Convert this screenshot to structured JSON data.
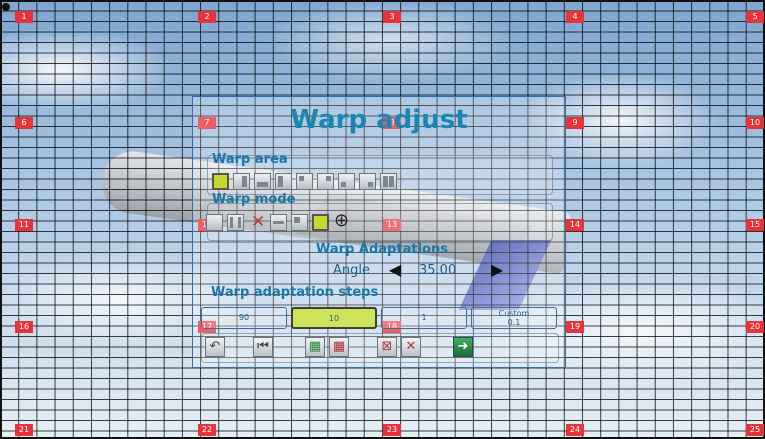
{
  "zones": [
    "1",
    "2",
    "3",
    "4",
    "5",
    "6",
    "7",
    "8",
    "9",
    "10",
    "11",
    "12",
    "13",
    "14",
    "15",
    "16",
    "17",
    "18",
    "19",
    "20",
    "21",
    "22",
    "23",
    "24",
    "25"
  ],
  "dialog": {
    "title": "Warp adjust",
    "warp_area": {
      "label": "Warp area",
      "selected_index": 0,
      "button_count": 9
    },
    "warp_mode": {
      "label": "Warp mode",
      "selected_index": 5,
      "icons": [
        "warp-mode-icon",
        "bars-icon",
        "close-icon",
        "grid-icon",
        "tiles-icon",
        "square-icon",
        "crosshair-icon"
      ]
    },
    "adaptations": {
      "label": "Warp Adaptations",
      "angle_label": "Angle",
      "angle_value": "35.00"
    },
    "steps": {
      "label": "Warp adaptation steps",
      "items": [
        {
          "value": "90"
        },
        {
          "value": "10",
          "selected": true
        },
        {
          "value": "1"
        },
        {
          "label": "Custom",
          "value": "0.1"
        }
      ]
    },
    "toolbar": [
      "undo-icon",
      "skip-back-icon",
      "grid-add-icon",
      "grid-remove-icon",
      "grid-reset-icon",
      "grid-clear-icon",
      "save-exit-icon"
    ]
  },
  "colors": {
    "accent": "#1c86b3",
    "selected": "#c5d82b",
    "zone_badge": "#e8333b"
  }
}
